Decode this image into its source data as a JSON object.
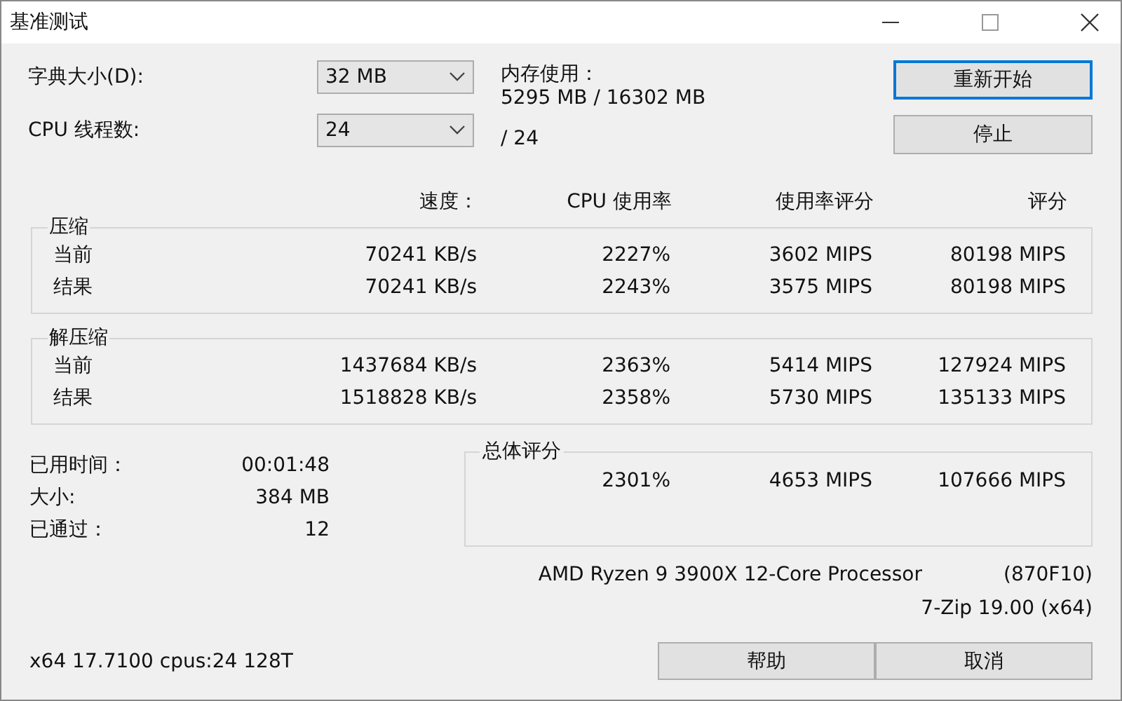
{
  "window": {
    "title": "基准测试"
  },
  "settings": [
    {
      "label": "字典大小(D):",
      "value": "32 MB"
    },
    {
      "label": "CPU 线程数:",
      "value": "24"
    }
  ],
  "memory": {
    "label": "内存使用：",
    "value": "5295 MB / 16302 MB"
  },
  "threads_total": "/ 24",
  "buttons": [
    {
      "label": "重新开始",
      "focused": true
    },
    {
      "label": "停止",
      "focused": false
    }
  ],
  "columns": [
    "速度：",
    "CPU 使用率",
    "使用率评分",
    "评分"
  ],
  "groups": [
    {
      "title": "压缩",
      "rows": [
        {
          "label": "当前",
          "speed": "70241 KB/s",
          "cpu": "2227%",
          "rating": "3602 MIPS",
          "score": "80198 MIPS"
        },
        {
          "label": "结果",
          "speed": "70241 KB/s",
          "cpu": "2243%",
          "rating": "3575 MIPS",
          "score": "80198 MIPS"
        }
      ]
    },
    {
      "title": "解压缩",
      "rows": [
        {
          "label": "当前",
          "speed": "1437684 KB/s",
          "cpu": "2363%",
          "rating": "5414 MIPS",
          "score": "127924 MIPS"
        },
        {
          "label": "结果",
          "speed": "1518828 KB/s",
          "cpu": "2358%",
          "rating": "5730 MIPS",
          "score": "135133 MIPS"
        }
      ]
    }
  ],
  "stats": [
    {
      "label": "已用时间：",
      "value": "00:01:48"
    },
    {
      "label": "大小:",
      "value": "384 MB"
    },
    {
      "label": "已通过：",
      "value": "12"
    }
  ],
  "total": {
    "title": "总体评分",
    "cpu": "2301%",
    "rating": "4653 MIPS",
    "score": "107666 MIPS"
  },
  "cpu_name": "AMD Ryzen 9 3900X 12-Core Processor",
  "cpu_id": "(870F10)",
  "version": "7-Zip 19.00 (x64)",
  "system_info": "x64 17.7100 cpus:24 128T",
  "bottom_buttons": [
    "帮助",
    "取消"
  ]
}
